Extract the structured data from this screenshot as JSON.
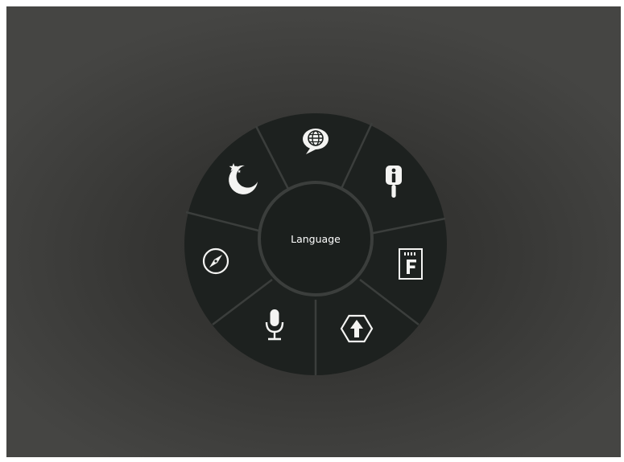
{
  "radial_menu": {
    "center_label": "Language",
    "segments": [
      {
        "icon": "globe-speech-icon"
      },
      {
        "icon": "info-pin-icon"
      },
      {
        "icon": "font-card-icon"
      },
      {
        "icon": "upload-hexagon-icon"
      },
      {
        "icon": "microphone-icon"
      },
      {
        "icon": "compass-icon"
      },
      {
        "icon": "moon-star-icon"
      }
    ]
  },
  "colors": {
    "menu_fill": "#1d211f",
    "divider": "#3b3e3c",
    "icon": "#f4f4f2",
    "center_text": "#ffffff"
  }
}
